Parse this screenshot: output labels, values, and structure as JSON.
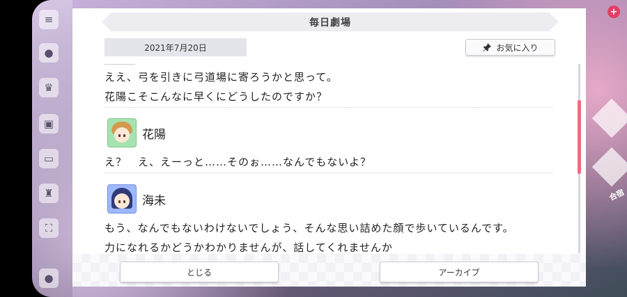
{
  "dialog": {
    "title": "毎日劇場",
    "date": "2021年7月20日",
    "favorite_label": "お気に入り"
  },
  "script": {
    "intro_lines": [
      "ええ、弓を引きに弓道場に寄ろうかと思って。",
      "花陽こそこんなに早くにどうしたのですか？"
    ],
    "blocks": [
      {
        "speaker": "花陽",
        "lines": [
          "え？　え、えーっと……そのぉ……なんでもないよ？"
        ]
      },
      {
        "speaker": "海未",
        "lines": [
          "もう、なんでもないわけないでしょう、そんな思い詰めた顔で歩いているんです。",
          "力になれるかどうかわかりませんが、話してくれませんか"
        ]
      }
    ]
  },
  "buttons": {
    "close": "とじる",
    "archive": "アーカイブ"
  },
  "background": {
    "tile_label": "合宿"
  },
  "colors": {
    "accent": "#f06b7f",
    "badge": "#e23f62"
  }
}
